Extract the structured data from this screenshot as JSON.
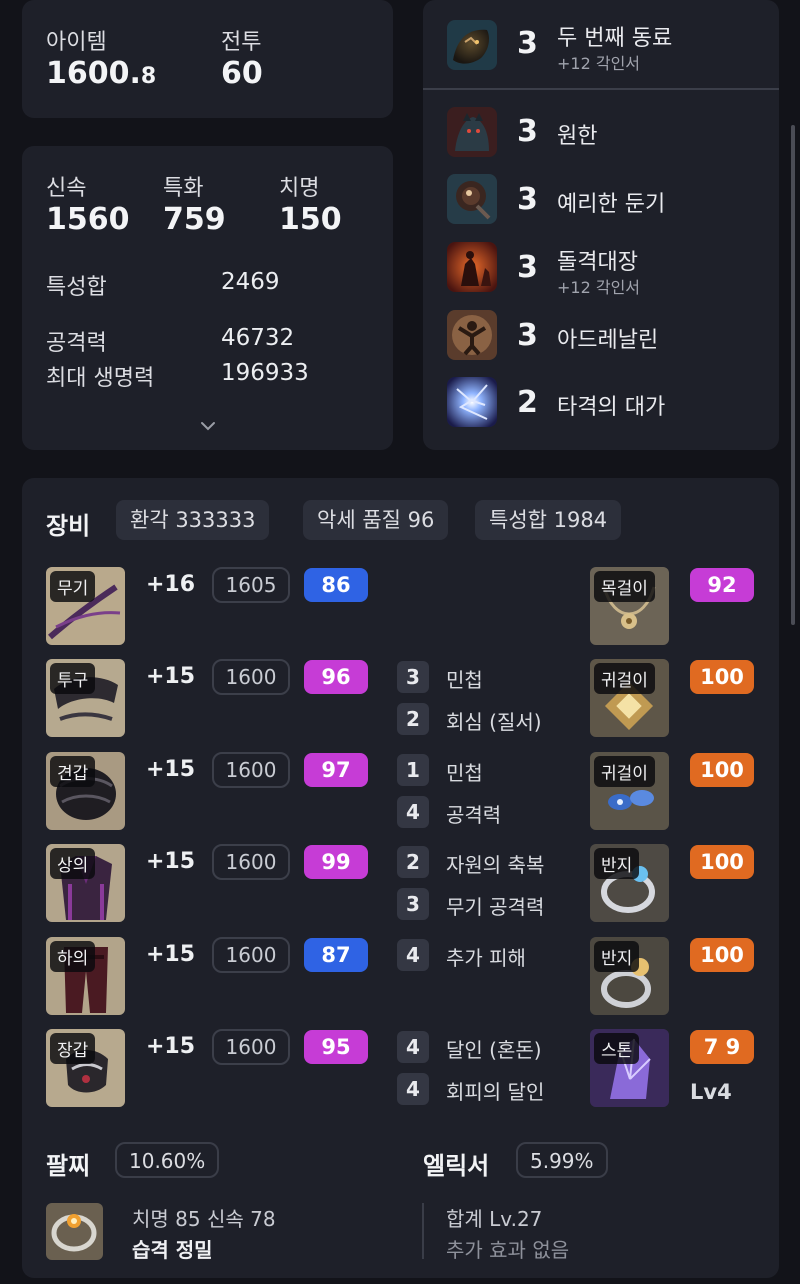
{
  "summary": {
    "item_label": "아이템",
    "item_value_main": "1600.",
    "item_value_decimal": "8",
    "combat_label": "전투",
    "combat_value": "60"
  },
  "stats": {
    "swift_label": "신속",
    "swift_value": "1560",
    "spec_label": "특화",
    "spec_value": "759",
    "crit_label": "치명",
    "crit_value": "150",
    "total_label": "특성합",
    "total_value": "2469",
    "atk_label": "공격력",
    "atk_value": "46732",
    "hp_label": "최대 생명력",
    "hp_value": "196933",
    "expand_icon": "chevron-down-icon"
  },
  "engravings": [
    {
      "level": "3",
      "name": "두 번째 동료",
      "sub": "+12 각인서",
      "icon": "dragon-icon"
    },
    {
      "level": "3",
      "name": "원한",
      "sub": "",
      "icon": "beast-icon"
    },
    {
      "level": "3",
      "name": "예리한 둔기",
      "sub": "",
      "icon": "mace-icon"
    },
    {
      "level": "3",
      "name": "돌격대장",
      "sub": "+12 각인서",
      "icon": "charge-icon"
    },
    {
      "level": "3",
      "name": "아드레날린",
      "sub": "",
      "icon": "adrenaline-icon"
    },
    {
      "level": "2",
      "name": "타격의 대가",
      "sub": "",
      "icon": "lightning-icon"
    }
  ],
  "equipment": {
    "title": "장비",
    "chips": [
      "환각 333333",
      "악세 품질 96",
      "특성합 1984"
    ],
    "gear": [
      {
        "slot": "무기",
        "enhance": "+16",
        "ilvl": "1605",
        "quality": "86",
        "qcolor": "#2f63e4",
        "bonus": []
      },
      {
        "slot": "투구",
        "enhance": "+15",
        "ilvl": "1600",
        "quality": "96",
        "qcolor": "#c63cd6",
        "bonus": [
          {
            "n": "3",
            "name": "민첩"
          },
          {
            "n": "2",
            "name": "회심 (질서)"
          }
        ]
      },
      {
        "slot": "견갑",
        "enhance": "+15",
        "ilvl": "1600",
        "quality": "97",
        "qcolor": "#c63cd6",
        "bonus": [
          {
            "n": "1",
            "name": "민첩"
          },
          {
            "n": "4",
            "name": "공격력"
          }
        ]
      },
      {
        "slot": "상의",
        "enhance": "+15",
        "ilvl": "1600",
        "quality": "99",
        "qcolor": "#c63cd6",
        "bonus": [
          {
            "n": "2",
            "name": "자원의 축복"
          },
          {
            "n": "3",
            "name": "무기 공격력"
          }
        ]
      },
      {
        "slot": "하의",
        "enhance": "+15",
        "ilvl": "1600",
        "quality": "87",
        "qcolor": "#2f63e4",
        "bonus": [
          {
            "n": "4",
            "name": "추가 피해"
          }
        ]
      },
      {
        "slot": "장갑",
        "enhance": "+15",
        "ilvl": "1600",
        "quality": "95",
        "qcolor": "#c63cd6",
        "bonus": [
          {
            "n": "4",
            "name": "달인 (혼돈)"
          },
          {
            "n": "4",
            "name": "회피의 달인"
          }
        ]
      }
    ],
    "accessories": [
      {
        "slot": "목걸이",
        "quality": "92",
        "qcolor": "#c63cd6"
      },
      {
        "slot": "귀걸이",
        "quality": "100",
        "qcolor": "#e06a21"
      },
      {
        "slot": "귀걸이",
        "quality": "100",
        "qcolor": "#e06a21"
      },
      {
        "slot": "반지",
        "quality": "100",
        "qcolor": "#e06a21"
      },
      {
        "slot": "반지",
        "quality": "100",
        "qcolor": "#e06a21"
      },
      {
        "slot": "스톤",
        "quality": "7 9",
        "qcolor": "#e06a21",
        "level": "Lv4"
      }
    ]
  },
  "bracelet": {
    "title": "팔찌",
    "percent": "10.60%",
    "stats": "치명 85  신속 78",
    "effects": "습격  정밀"
  },
  "elixir": {
    "title": "엘릭서",
    "percent": "5.99%",
    "total": "합계 Lv.27",
    "extra": "추가 효과 없음"
  }
}
